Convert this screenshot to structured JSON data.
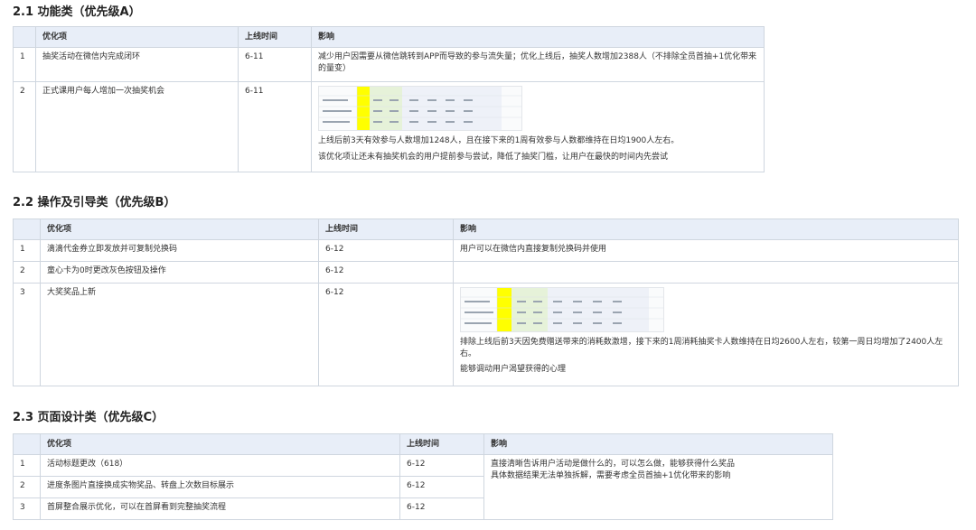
{
  "sections": [
    {
      "title": "2.1 功能类（优先级A）",
      "headers": [
        "",
        "优化项",
        "上线时间",
        "影响"
      ],
      "rows": [
        {
          "no": "1",
          "item": "抽奖活动在微信内完成闭环",
          "date": "6-11",
          "impact": [
            "减少用户因需要从微信跳转到APP而导致的参与流失量；优化上线后，抽奖人数增加2388人（不排除全员首抽+1优化带来的量变）"
          ]
        },
        {
          "no": "2",
          "item": "正式课用户每人增加一次抽奖机会",
          "date": "6-11",
          "impact": [
            "上线后前3天有效参与人数增加1248人，且在接下来的1周有效参与人数都维持在日均1900人左右。",
            "该优化项让还未有抽奖机会的用户提前参与尝试，降低了抽奖门槛，让用户在最快的时间内先尝试"
          ]
        }
      ]
    },
    {
      "title": "2.2 操作及引导类（优先级B）",
      "headers": [
        "",
        "优化项",
        "上线时间",
        "影响"
      ],
      "rows": [
        {
          "no": "1",
          "item": "滴滴代金券立即发放并可复制兑换码",
          "date": "6-12",
          "impact": [
            "用户可以在微信内直接复制兑换码并使用"
          ]
        },
        {
          "no": "2",
          "item": "童心卡为0时更改灰色按钮及操作",
          "date": "6-12",
          "impact": []
        },
        {
          "no": "3",
          "item": "大奖奖品上新",
          "date": "6-12",
          "impact": [
            "排除上线后前3天因免费赠送带来的消耗数激增，接下来的1周消耗抽奖卡人数维持在日均2600人左右，较第一周日均增加了2400人左右。",
            "能够调动用户渴望获得的心理"
          ]
        }
      ]
    },
    {
      "title": "2.3 页面设计类（优先级C）",
      "headers": [
        "",
        "优化项",
        "上线时间",
        "影响"
      ],
      "rows": [
        {
          "no": "1",
          "item": "活动标题更改（618）",
          "date": "6-12"
        },
        {
          "no": "2",
          "item": "进度条图片直接换成实物奖品、转盘上次数目标展示",
          "date": "6-12"
        },
        {
          "no": "3",
          "item": "首屏整合展示优化，可以在首屏看到完整抽奖流程",
          "date": "6-12"
        }
      ],
      "merged_impact": [
        "直接清晰告诉用户活动是做什么的，可以怎么做，能够获得什么奖品",
        "具体数据结果无法单独拆解，需要考虑全员首抽+1优化带来的影响"
      ]
    }
  ]
}
